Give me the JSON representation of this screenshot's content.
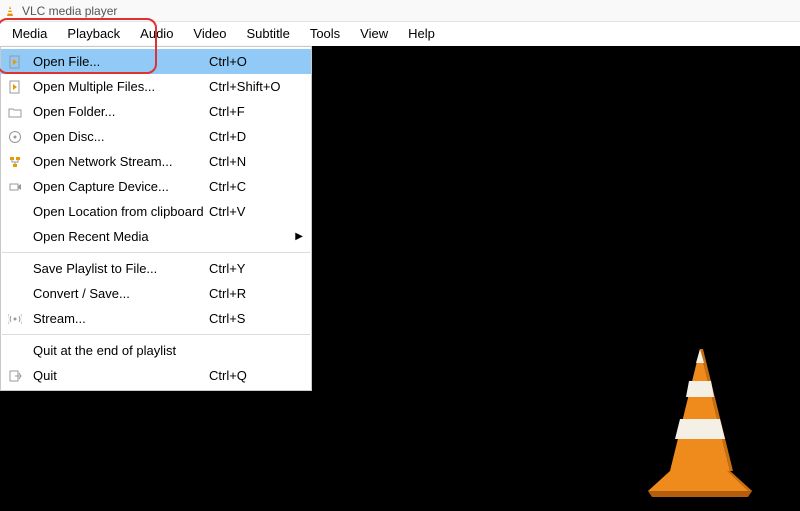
{
  "titlebar": {
    "title": "VLC media player"
  },
  "menubar": {
    "items": [
      "Media",
      "Playback",
      "Audio",
      "Video",
      "Subtitle",
      "Tools",
      "View",
      "Help"
    ]
  },
  "media_menu": {
    "items": [
      {
        "icon": "file-play",
        "label": "Open File...",
        "shortcut": "Ctrl+O",
        "highlight": true
      },
      {
        "icon": "file-play",
        "label": "Open Multiple Files...",
        "shortcut": "Ctrl+Shift+O"
      },
      {
        "icon": "folder",
        "label": "Open Folder...",
        "shortcut": "Ctrl+F"
      },
      {
        "icon": "disc",
        "label": "Open Disc...",
        "shortcut": "Ctrl+D"
      },
      {
        "icon": "network",
        "label": "Open Network Stream...",
        "shortcut": "Ctrl+N"
      },
      {
        "icon": "capture",
        "label": "Open Capture Device...",
        "shortcut": "Ctrl+C"
      },
      {
        "icon": "",
        "label": "Open Location from clipboard",
        "shortcut": "Ctrl+V"
      },
      {
        "icon": "",
        "label": "Open Recent Media",
        "submenu": true
      },
      {
        "separator": true
      },
      {
        "icon": "",
        "label": "Save Playlist to File...",
        "shortcut": "Ctrl+Y"
      },
      {
        "icon": "",
        "label": "Convert / Save...",
        "shortcut": "Ctrl+R"
      },
      {
        "icon": "stream",
        "label": "Stream...",
        "shortcut": "Ctrl+S"
      },
      {
        "separator": true
      },
      {
        "icon": "",
        "label": "Quit at the end of playlist"
      },
      {
        "icon": "quit",
        "label": "Quit",
        "shortcut": "Ctrl+Q"
      }
    ]
  }
}
